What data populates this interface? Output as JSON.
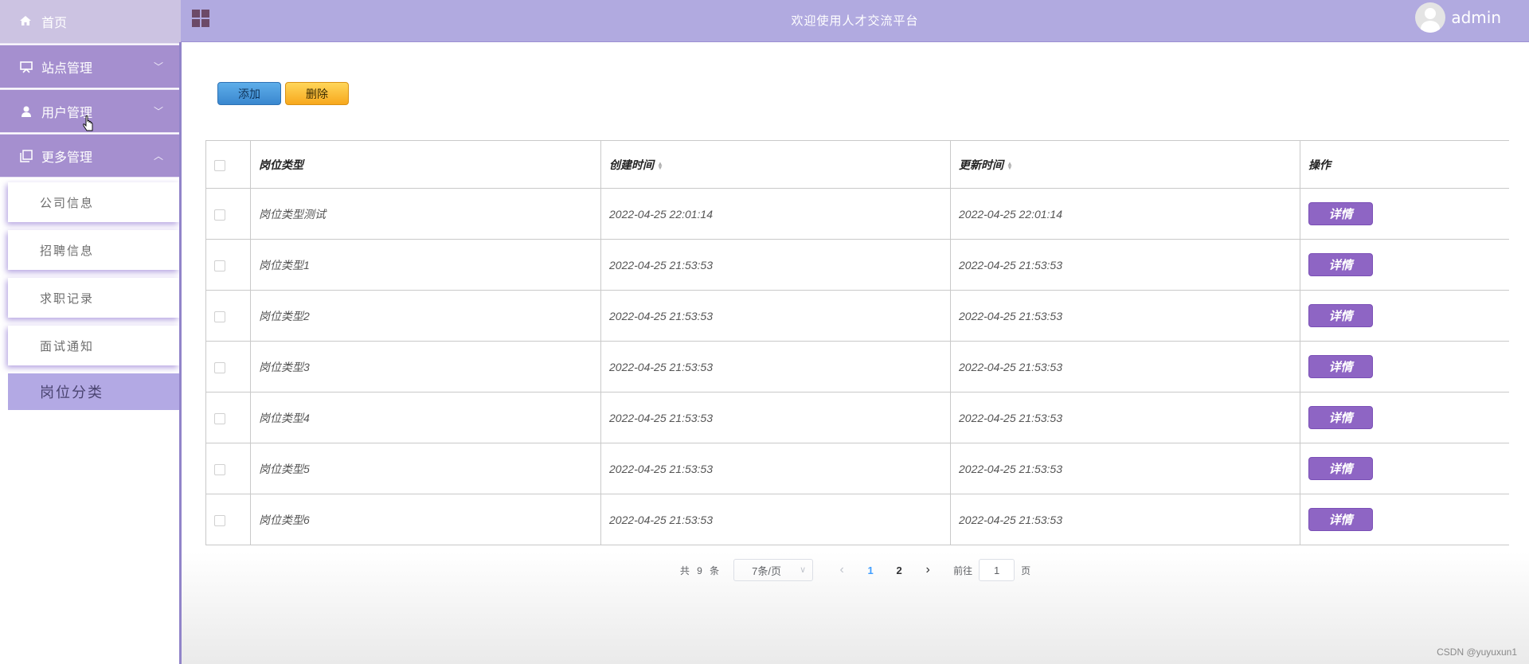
{
  "sidebar": {
    "home": "首页",
    "menus": [
      {
        "label": "站点管理",
        "icon": "monitor-icon",
        "arrow": "﹀"
      },
      {
        "label": "用户管理",
        "icon": "user-icon",
        "arrow": "﹀"
      },
      {
        "label": "更多管理",
        "icon": "copy-icon",
        "arrow": "︿"
      }
    ],
    "sub_items": [
      "公司信息",
      "招聘信息",
      "求职记录",
      "面试通知",
      "岗位分类"
    ]
  },
  "header": {
    "title": "欢迎使用人才交流平台",
    "user": "admin"
  },
  "toolbar": {
    "add_label": "添加",
    "delete_label": "删除"
  },
  "table": {
    "columns": [
      "岗位类型",
      "创建时间",
      "更新时间",
      "操作"
    ],
    "detail_label": "详情",
    "rows": [
      {
        "type": "岗位类型测试",
        "created": "2022-04-25 22:01:14",
        "updated": "2022-04-25 22:01:14"
      },
      {
        "type": "岗位类型1",
        "created": "2022-04-25 21:53:53",
        "updated": "2022-04-25 21:53:53"
      },
      {
        "type": "岗位类型2",
        "created": "2022-04-25 21:53:53",
        "updated": "2022-04-25 21:53:53"
      },
      {
        "type": "岗位类型3",
        "created": "2022-04-25 21:53:53",
        "updated": "2022-04-25 21:53:53"
      },
      {
        "type": "岗位类型4",
        "created": "2022-04-25 21:53:53",
        "updated": "2022-04-25 21:53:53"
      },
      {
        "type": "岗位类型5",
        "created": "2022-04-25 21:53:53",
        "updated": "2022-04-25 21:53:53"
      },
      {
        "type": "岗位类型6",
        "created": "2022-04-25 21:53:53",
        "updated": "2022-04-25 21:53:53"
      }
    ]
  },
  "pagination": {
    "total_label": "共 9 条",
    "page_size": "7条/页",
    "pages": [
      "1",
      "2"
    ],
    "current": "1",
    "goto_prefix": "前往",
    "goto_value": "1",
    "goto_suffix": "页"
  },
  "watermark": "CSDN @yuyuxun1",
  "colors": {
    "sidebar_menu": "#a58fcf",
    "header": "#b1aae0",
    "detail_button": "#8e65c4",
    "add_button": "#3a87cf",
    "delete_button": "#f7a81d",
    "active_page": "#409eff"
  }
}
